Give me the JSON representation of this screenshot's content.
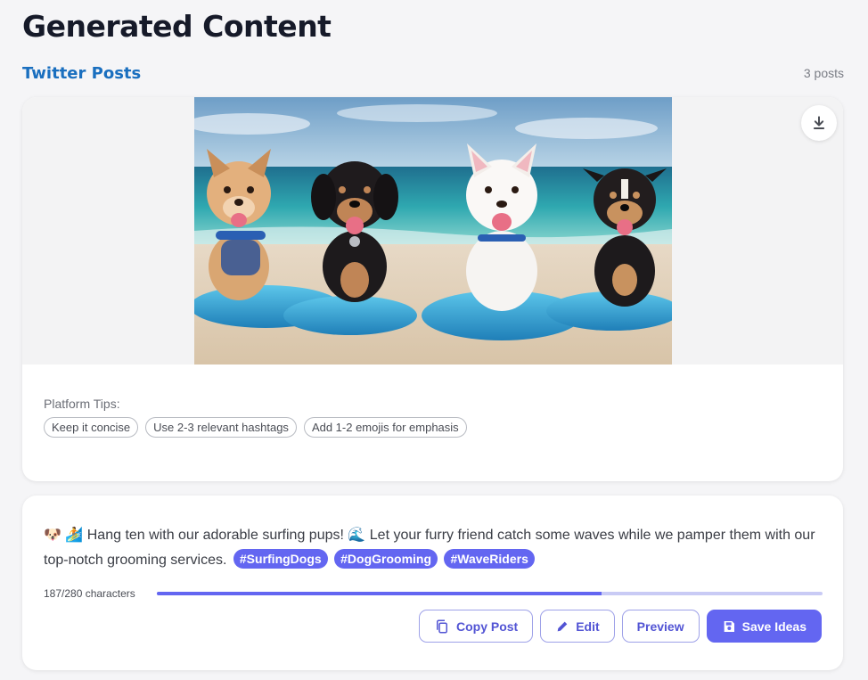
{
  "page": {
    "title": "Generated Content"
  },
  "section": {
    "title": "Twitter Posts",
    "count": "3 posts"
  },
  "image_card": {
    "image_icon": "surfing-puppies-photo",
    "download_icon": "download-icon",
    "tips_label": "Platform Tips:",
    "tips": [
      "Keep it concise",
      "Use 2-3 relevant hashtags",
      "Add 1-2 emojis for emphasis"
    ]
  },
  "post": {
    "emoji_1": "🐶",
    "emoji_2": "🏄",
    "text_part1": "Hang ten with our adorable surfing pups!",
    "emoji_3": "🌊",
    "text_part2": "Let your furry friend catch some waves while we pamper them with our top-notch grooming services.",
    "hashtags": [
      "#SurfingDogs",
      "#DogGrooming",
      "#WaveRiders"
    ],
    "char_count": "187/280 characters",
    "char_fraction": 0.668
  },
  "actions": {
    "copy": "Copy Post",
    "edit": "Edit",
    "preview": "Preview",
    "save": "Save Ideas"
  },
  "colors": {
    "accent": "#6366f1",
    "section_title": "#1a6fbf",
    "track": "#c9cbf5"
  }
}
